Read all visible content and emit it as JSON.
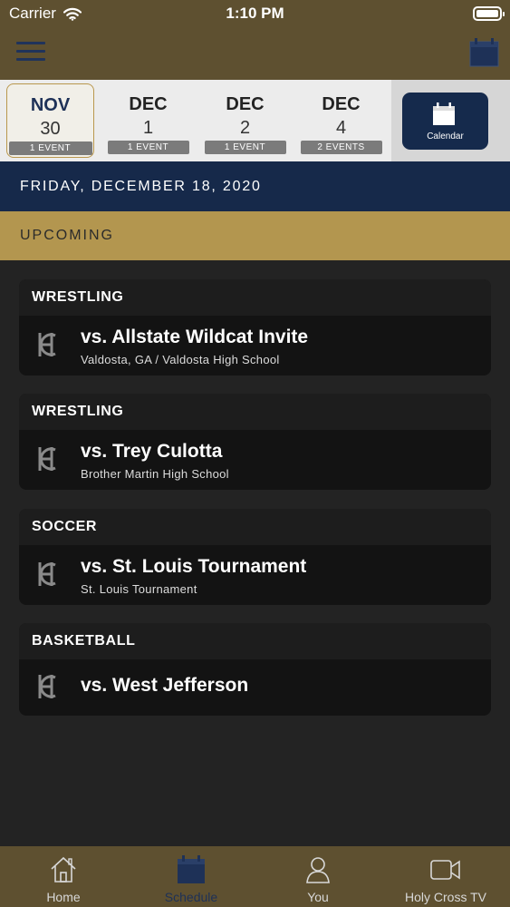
{
  "status_bar": {
    "carrier": "Carrier",
    "time": "1:10 PM"
  },
  "date_strip": {
    "days": [
      {
        "month": "NOV",
        "day": "30",
        "events": "1 EVENT",
        "selected": true
      },
      {
        "month": "DEC",
        "day": "1",
        "events": "1 EVENT",
        "selected": false
      },
      {
        "month": "DEC",
        "day": "2",
        "events": "1 EVENT",
        "selected": false
      },
      {
        "month": "DEC",
        "day": "4",
        "events": "2 EVENTS",
        "selected": false
      }
    ],
    "calendar_label": "Calendar"
  },
  "date_header": "FRIDAY, DECEMBER 18, 2020",
  "section_header": "UPCOMING",
  "events": [
    {
      "sport": "WRESTLING",
      "title": "vs. Allstate Wildcat Invite",
      "location": "Valdosta, GA / Valdosta High School"
    },
    {
      "sport": "WRESTLING",
      "title": "vs. Trey Culotta",
      "location": "Brother Martin High School"
    },
    {
      "sport": "SOCCER",
      "title": "vs. St. Louis Tournament",
      "location": "St. Louis Tournament"
    },
    {
      "sport": "BASKETBALL",
      "title": "vs. West Jefferson",
      "location": ""
    }
  ],
  "tab_bar": {
    "tabs": [
      {
        "label": "Home",
        "icon": "home-icon",
        "active": false
      },
      {
        "label": "Schedule",
        "icon": "calendar-icon",
        "active": true
      },
      {
        "label": "You",
        "icon": "person-icon",
        "active": false
      },
      {
        "label": "Holy Cross TV",
        "icon": "video-camera-icon",
        "active": false
      }
    ]
  },
  "colors": {
    "nav_bar": "#5e5030",
    "navy": "#16294a",
    "gold": "#b3964f",
    "background": "#232323",
    "card": "#131313"
  }
}
